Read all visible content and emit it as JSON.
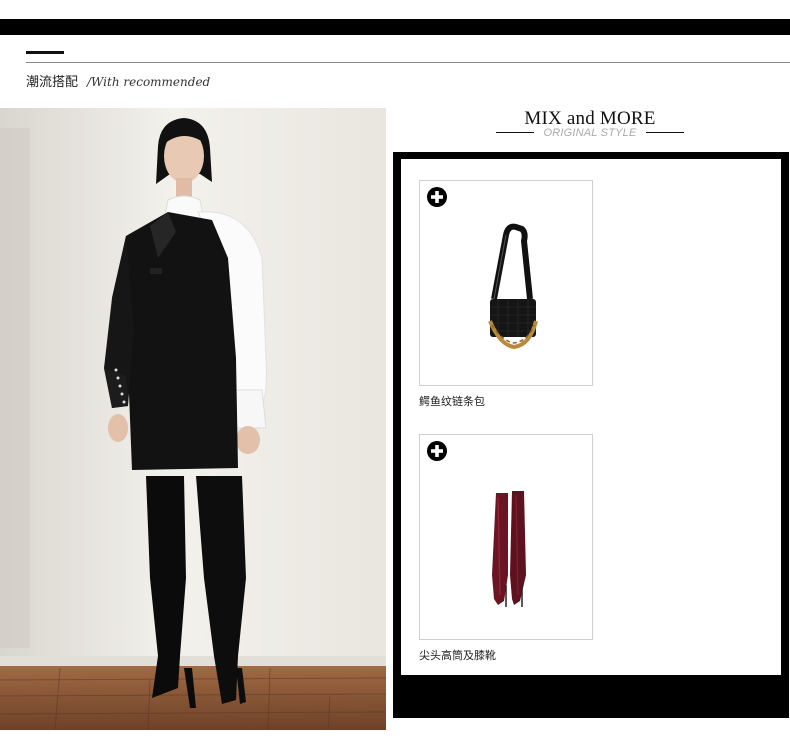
{
  "header": {
    "title_cn": "潮流搭配",
    "title_en": "/With recommended"
  },
  "mix": {
    "title": "MIX and MORE",
    "subtitle": "ORIGINAL STYLE"
  },
  "products": [
    {
      "name": "鳄鱼纹链条包",
      "icon": "plus-circle-icon"
    },
    {
      "name": "尖头高筒及膝靴",
      "icon": "plus-circle-icon"
    }
  ],
  "colors": {
    "black": "#000000",
    "boot_burgundy": "#6b1524",
    "subtitle_gray": "#aaaaaa",
    "photo_wall": "#efede8",
    "photo_floor": "#8b5a3a"
  }
}
